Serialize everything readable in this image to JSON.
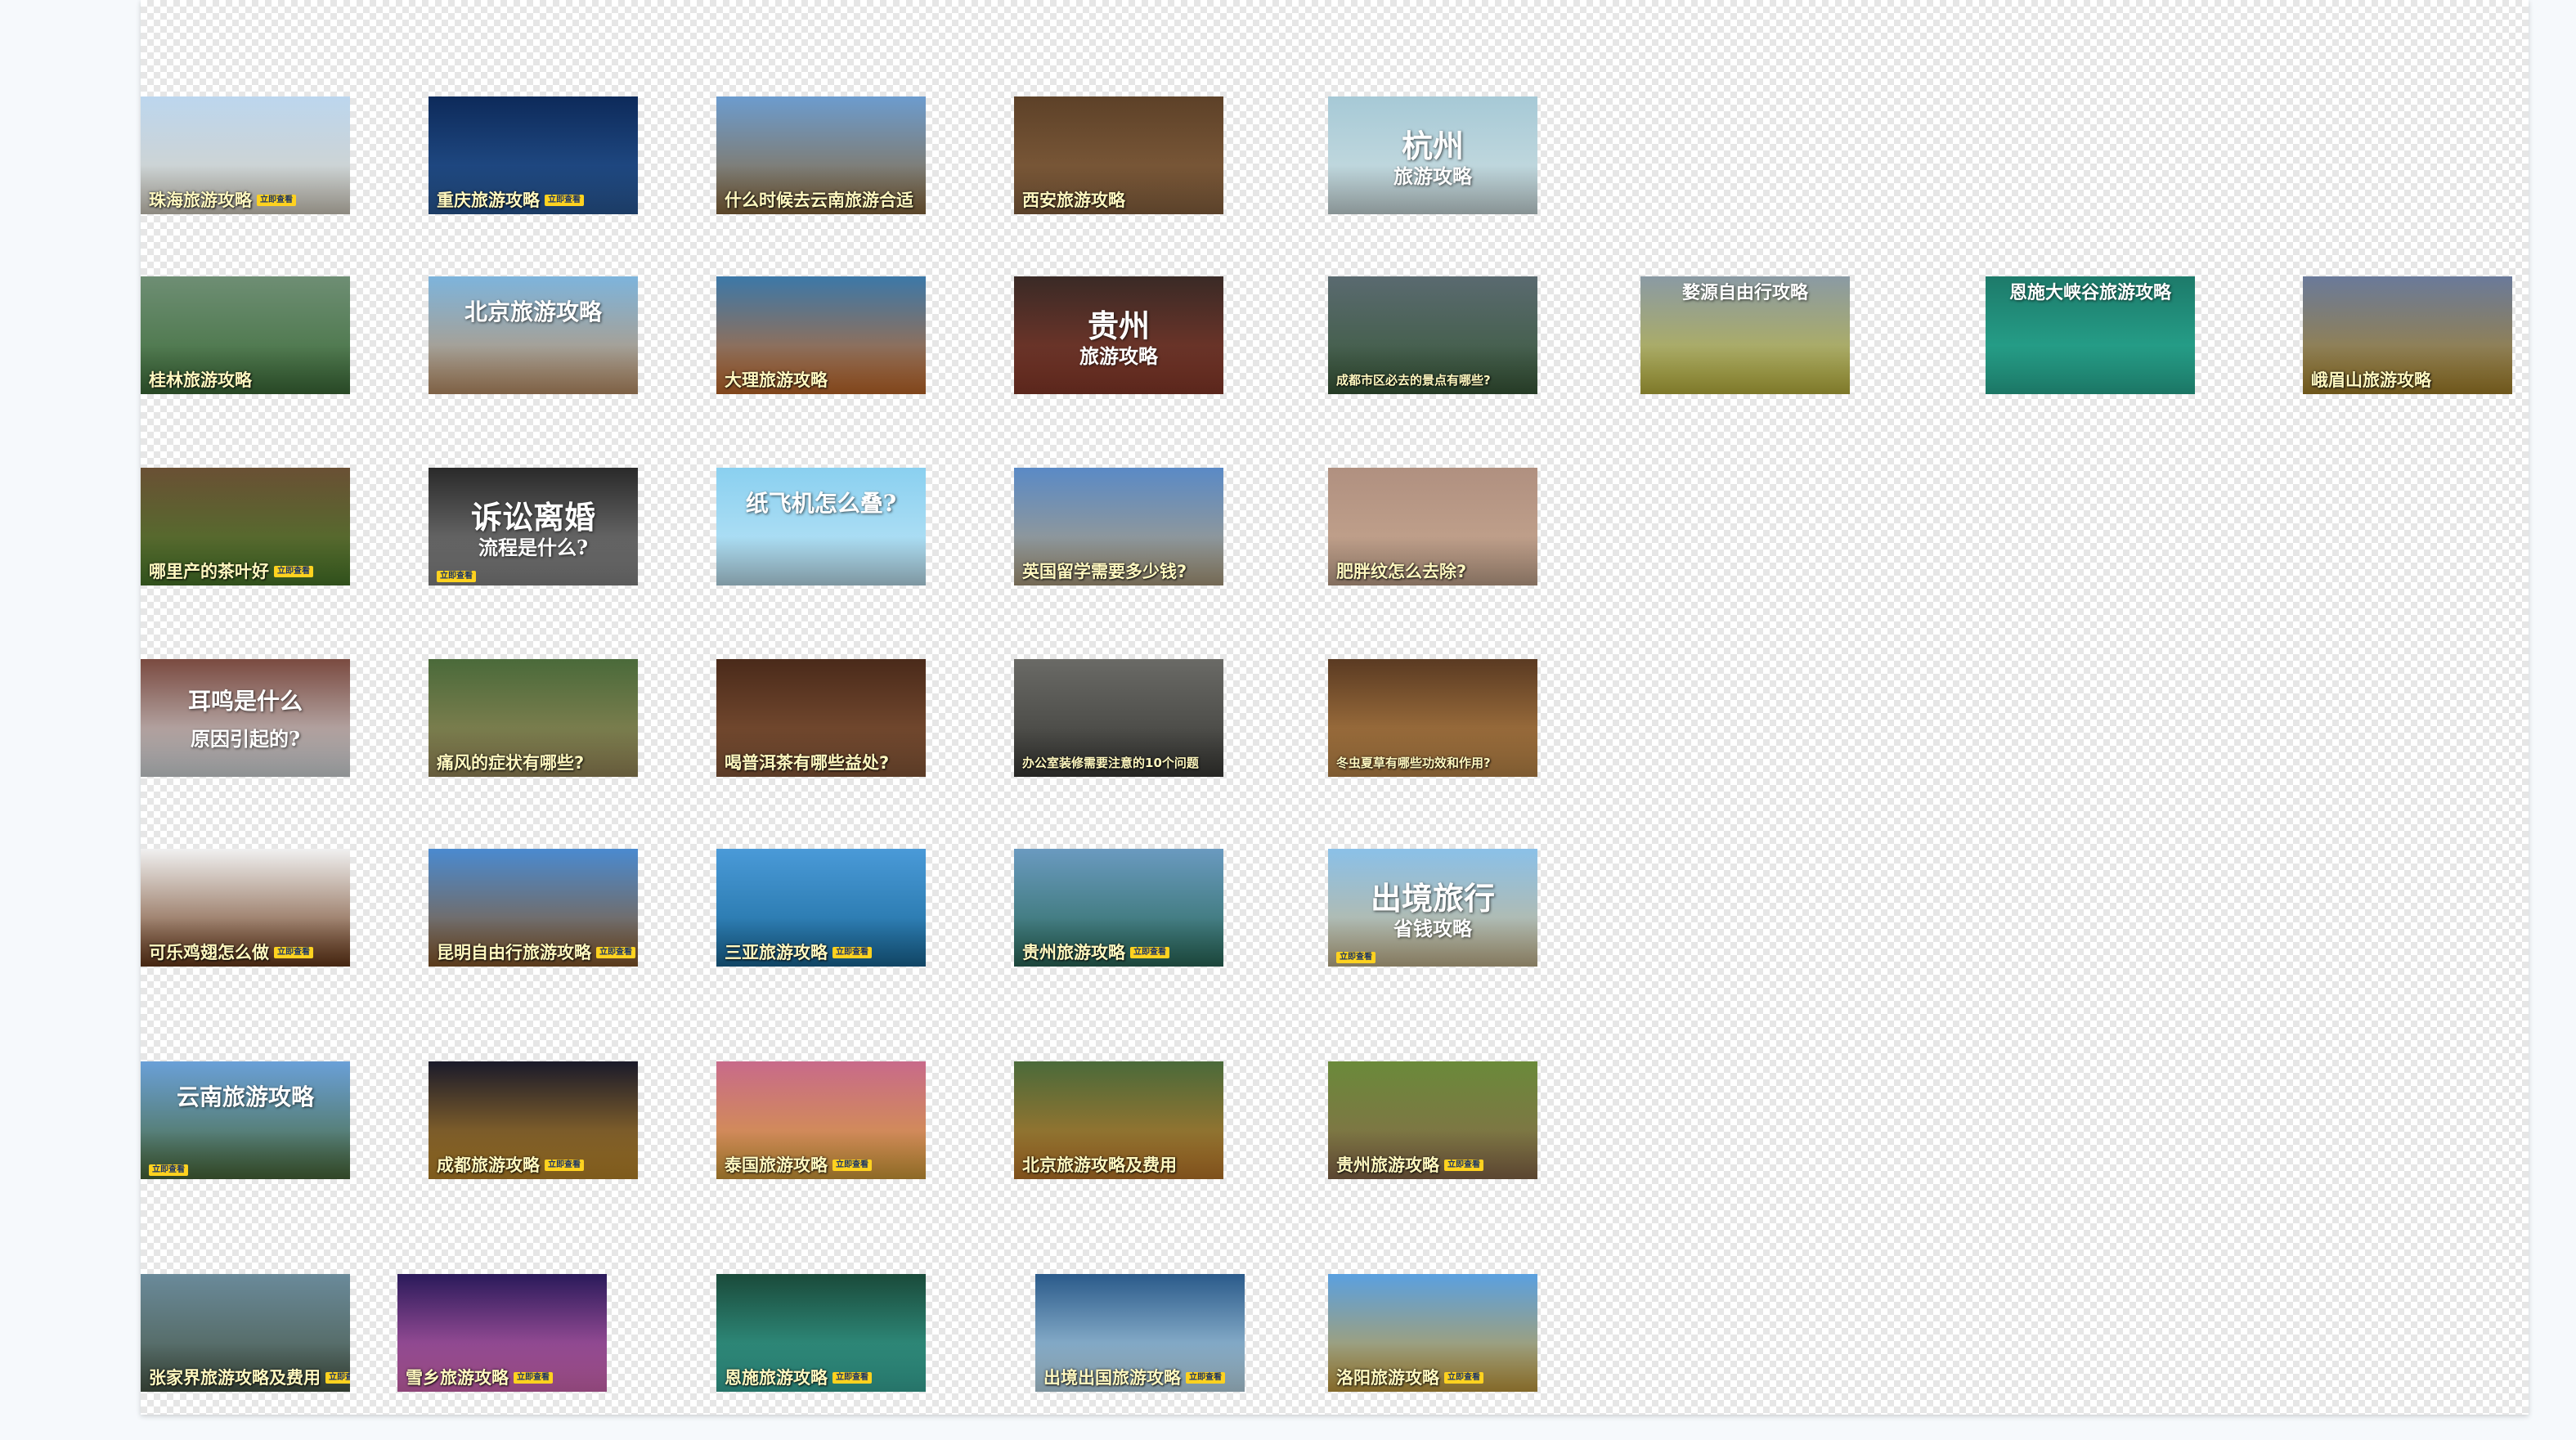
{
  "badge_text": "立即查看",
  "thumbnails": [
    {
      "id": "zhuhai",
      "caption": "珠海旅游攻略",
      "badge": true,
      "bg": [
        "#bcd6ee",
        "#d8d2c4"
      ]
    },
    {
      "id": "chongqing",
      "caption": "重庆旅游攻略",
      "badge": true,
      "bg": [
        "#0d2a5a",
        "#2a5b9a"
      ]
    },
    {
      "id": "yunnan-when",
      "caption": "什么时候去云南旅游合适",
      "badge": false,
      "bg": [
        "#6c9ccf",
        "#8a6a3e"
      ]
    },
    {
      "id": "xian",
      "caption": "西安旅游攻略",
      "badge": false,
      "bg": [
        "#5d4128",
        "#8a6440"
      ]
    },
    {
      "id": "hangzhou",
      "caption": "",
      "badge": false,
      "big1": "杭州",
      "big2": "旅游攻略",
      "bg": [
        "#a6c9d6",
        "#cfe0e2"
      ]
    },
    {
      "id": "guilin",
      "caption": "桂林旅游攻略",
      "badge": false,
      "bg": [
        "#6e8e74",
        "#3e6e3a"
      ]
    },
    {
      "id": "beijing",
      "caption": "",
      "badge": false,
      "big1": "北京旅游攻略",
      "big2": "",
      "bg": [
        "#7db4dc",
        "#c0946a"
      ]
    },
    {
      "id": "dali",
      "caption": "大理旅游攻略",
      "badge": false,
      "bg": [
        "#3c78a8",
        "#c46a2a"
      ]
    },
    {
      "id": "guizhou-1",
      "caption": "",
      "badge": false,
      "big1": "贵州",
      "big2": "旅游攻略",
      "bg": [
        "#3a2a26",
        "#8a3a2a"
      ]
    },
    {
      "id": "chengdu-sights",
      "caption": "成都市区必去的景点有哪些?",
      "badge": false,
      "bg": [
        "#5a6a70",
        "#3a5a3a"
      ]
    },
    {
      "id": "wuyuan",
      "caption": "",
      "badge": false,
      "top": "婺源自由行攻略",
      "bg": [
        "#8a9aa4",
        "#c0b840"
      ]
    },
    {
      "id": "enshi-canyon",
      "caption": "",
      "badge": false,
      "top": "恩施大峡谷旅游攻略",
      "bg": [
        "#1d7a6a",
        "#2ab49a"
      ]
    },
    {
      "id": "emeishan",
      "caption": "峨眉山旅游攻略",
      "badge": false,
      "bg": [
        "#6a7a9a",
        "#a8842a"
      ]
    },
    {
      "id": "tea",
      "caption": "哪里产的茶叶好",
      "badge": true,
      "bg": [
        "#6a5034",
        "#4a7a2a"
      ]
    },
    {
      "id": "divorce",
      "caption": "",
      "badge": true,
      "big1": "诉讼离婚",
      "big2": "流程是什么?",
      "bg": [
        "#2a2a2a",
        "#8a8a8a"
      ]
    },
    {
      "id": "paper-plane",
      "caption": "",
      "badge": false,
      "big1": "纸飞机怎么叠?",
      "big2": "",
      "bg": [
        "#8ad0f0",
        "#c0e6f6"
      ]
    },
    {
      "id": "uk-study",
      "caption": "英国留学需要多少钱?",
      "badge": false,
      "bg": [
        "#5a8ac6",
        "#b0a080"
      ]
    },
    {
      "id": "stretch-marks",
      "caption": "肥胖纹怎么去除?",
      "badge": false,
      "bg": [
        "#b09080",
        "#c8a890"
      ]
    },
    {
      "id": "tinnitus",
      "caption": "",
      "badge": false,
      "big1": "耳鸣是什么",
      "big2": "原因引起的?",
      "bg": [
        "#7a4a40",
        "#d8dde0"
      ]
    },
    {
      "id": "gout",
      "caption": "痛风的症状有哪些?",
      "badge": false,
      "bg": [
        "#4a6a3a",
        "#9a8a5a"
      ]
    },
    {
      "id": "puer",
      "caption": "喝普洱茶有哪些益处?",
      "badge": false,
      "bg": [
        "#4a2a1a",
        "#8a5a3a"
      ]
    },
    {
      "id": "office",
      "caption": "办公室装修需要注意的10个问题",
      "badge": false,
      "bg": [
        "#6a6a66",
        "#3a3a36"
      ]
    },
    {
      "id": "cordyceps",
      "caption": "冬虫夏草有哪些功效和作用?",
      "badge": false,
      "bg": [
        "#5a3a22",
        "#c08a4a"
      ]
    },
    {
      "id": "coke-wings",
      "caption": "可乐鸡翅怎么做",
      "badge": true,
      "bg": [
        "#f0f0f0",
        "#6a3a1a"
      ]
    },
    {
      "id": "kunming",
      "caption": "昆明自由行旅游攻略",
      "badge": true,
      "bg": [
        "#4a8ad0",
        "#8a5a2a"
      ]
    },
    {
      "id": "sanya",
      "caption": "三亚旅游攻略",
      "badge": true,
      "bg": [
        "#4a9ad8",
        "#1a6a9a"
      ]
    },
    {
      "id": "guizhou-2",
      "caption": "贵州旅游攻略",
      "badge": true,
      "bg": [
        "#6a9ac0",
        "#2a6a5a"
      ]
    },
    {
      "id": "outbound-save",
      "caption": "",
      "badge": true,
      "big1": "出境旅行",
      "big2": "省钱攻略",
      "bg": [
        "#8ac0e8",
        "#c8b890"
      ]
    },
    {
      "id": "yunnan",
      "caption": "",
      "badge": true,
      "big1": "云南旅游攻略",
      "big2": "",
      "bg": [
        "#6aa0d8",
        "#4a6a3a"
      ]
    },
    {
      "id": "chengdu",
      "caption": "成都旅游攻略",
      "badge": true,
      "bg": [
        "#1a1a2a",
        "#c08a2a"
      ]
    },
    {
      "id": "thailand",
      "caption": "泰国旅游攻略",
      "badge": true,
      "bg": [
        "#c86a8a",
        "#d8a03a"
      ]
    },
    {
      "id": "beijing-cost",
      "caption": "北京旅游攻略及费用",
      "badge": false,
      "bg": [
        "#4a6a3a",
        "#c07a2a"
      ]
    },
    {
      "id": "guizhou-3",
      "caption": "贵州旅游攻略",
      "badge": true,
      "bg": [
        "#6a8a3a",
        "#8a6a4a"
      ]
    },
    {
      "id": "zhangjiajie",
      "caption": "张家界旅游攻略及费用",
      "badge": true,
      "bg": [
        "#6a8a9a",
        "#4a5a4a"
      ]
    },
    {
      "id": "snow-town",
      "caption": "雪乡旅游攻略",
      "badge": true,
      "bg": [
        "#2a1a5a",
        "#d86ab8"
      ]
    },
    {
      "id": "enshi",
      "caption": "恩施旅游攻略",
      "badge": true,
      "bg": [
        "#1a4a3a",
        "#3ab0a0"
      ]
    },
    {
      "id": "outbound",
      "caption": "出境出国旅游攻略",
      "badge": true,
      "bg": [
        "#2a5a8a",
        "#c0e0f0"
      ]
    },
    {
      "id": "luoyang",
      "caption": "洛阳旅游攻略",
      "badge": true,
      "bg": [
        "#5aa0e0",
        "#c8a040"
      ]
    }
  ]
}
